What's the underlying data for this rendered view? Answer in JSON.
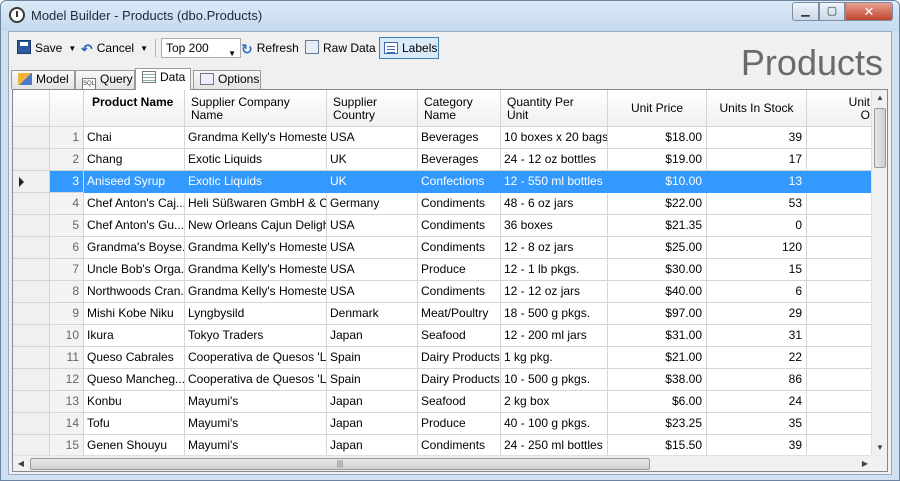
{
  "window": {
    "title": "Model Builder - Products (dbo.Products)",
    "min": "▁",
    "max": "▢",
    "close": "✕"
  },
  "toolbar": {
    "save_label": "Save",
    "cancel_label": "Cancel",
    "top_value": "Top 200",
    "refresh_label": "Refresh",
    "raw_data_label": "Raw Data",
    "labels_label": "Labels"
  },
  "heading": "Products",
  "tabs": [
    "Model",
    "Query",
    "Data",
    "Options"
  ],
  "active_tab": "Data",
  "columns": [
    "Product Name",
    "Supplier Company Name",
    "Supplier Country",
    "Category Name",
    "Quantity Per Unit",
    "Unit Price",
    "Units In Stock",
    "Unit O"
  ],
  "rows": [
    [
      "1",
      "Chai",
      "Grandma Kelly's Homestead",
      "USA",
      "Beverages",
      "10 boxes x 20 bags",
      "$18.00",
      "39"
    ],
    [
      "2",
      "Chang",
      "Exotic Liquids",
      "UK",
      "Beverages",
      "24 - 12 oz bottles",
      "$19.00",
      "17"
    ],
    [
      "3",
      "Aniseed Syrup",
      "Exotic Liquids",
      "UK",
      "Confections",
      "12 - 550 ml bottles",
      "$10.00",
      "13"
    ],
    [
      "4",
      "Chef Anton's Caj...",
      "Heli Süßwaren GmbH & C...",
      "Germany",
      "Condiments",
      "48 - 6 oz jars",
      "$22.00",
      "53"
    ],
    [
      "5",
      "Chef Anton's Gu...",
      "New Orleans Cajun Delights",
      "USA",
      "Condiments",
      "36 boxes",
      "$21.35",
      "0"
    ],
    [
      "6",
      "Grandma's Boyse...",
      "Grandma Kelly's Homestead",
      "USA",
      "Condiments",
      "12 - 8 oz jars",
      "$25.00",
      "120"
    ],
    [
      "7",
      "Uncle Bob's Orga...",
      "Grandma Kelly's Homestead",
      "USA",
      "Produce",
      "12 - 1 lb pkgs.",
      "$30.00",
      "15"
    ],
    [
      "8",
      "Northwoods Cran...",
      "Grandma Kelly's Homestead",
      "USA",
      "Condiments",
      "12 - 12 oz jars",
      "$40.00",
      "6"
    ],
    [
      "9",
      "Mishi Kobe Niku",
      "Lyngbysild",
      "Denmark",
      "Meat/Poultry",
      "18 - 500 g pkgs.",
      "$97.00",
      "29"
    ],
    [
      "10",
      "Ikura",
      "Tokyo Traders",
      "Japan",
      "Seafood",
      "12 - 200 ml jars",
      "$31.00",
      "31"
    ],
    [
      "11",
      "Queso Cabrales",
      "Cooperativa de Quesos 'L...",
      "Spain",
      "Dairy Products",
      "1 kg pkg.",
      "$21.00",
      "22"
    ],
    [
      "12",
      "Queso Mancheg...",
      "Cooperativa de Quesos 'L...",
      "Spain",
      "Dairy Products",
      "10 - 500 g pkgs.",
      "$38.00",
      "86"
    ],
    [
      "13",
      "Konbu",
      "Mayumi's",
      "Japan",
      "Seafood",
      "2 kg box",
      "$6.00",
      "24"
    ],
    [
      "14",
      "Tofu",
      "Mayumi's",
      "Japan",
      "Produce",
      "40 - 100 g pkgs.",
      "$23.25",
      "35"
    ],
    [
      "15",
      "Genen Shouyu",
      "Mayumi's",
      "Japan",
      "Condiments",
      "24 - 250 ml bottles",
      "$15.50",
      "39"
    ]
  ],
  "selected_row": 3
}
